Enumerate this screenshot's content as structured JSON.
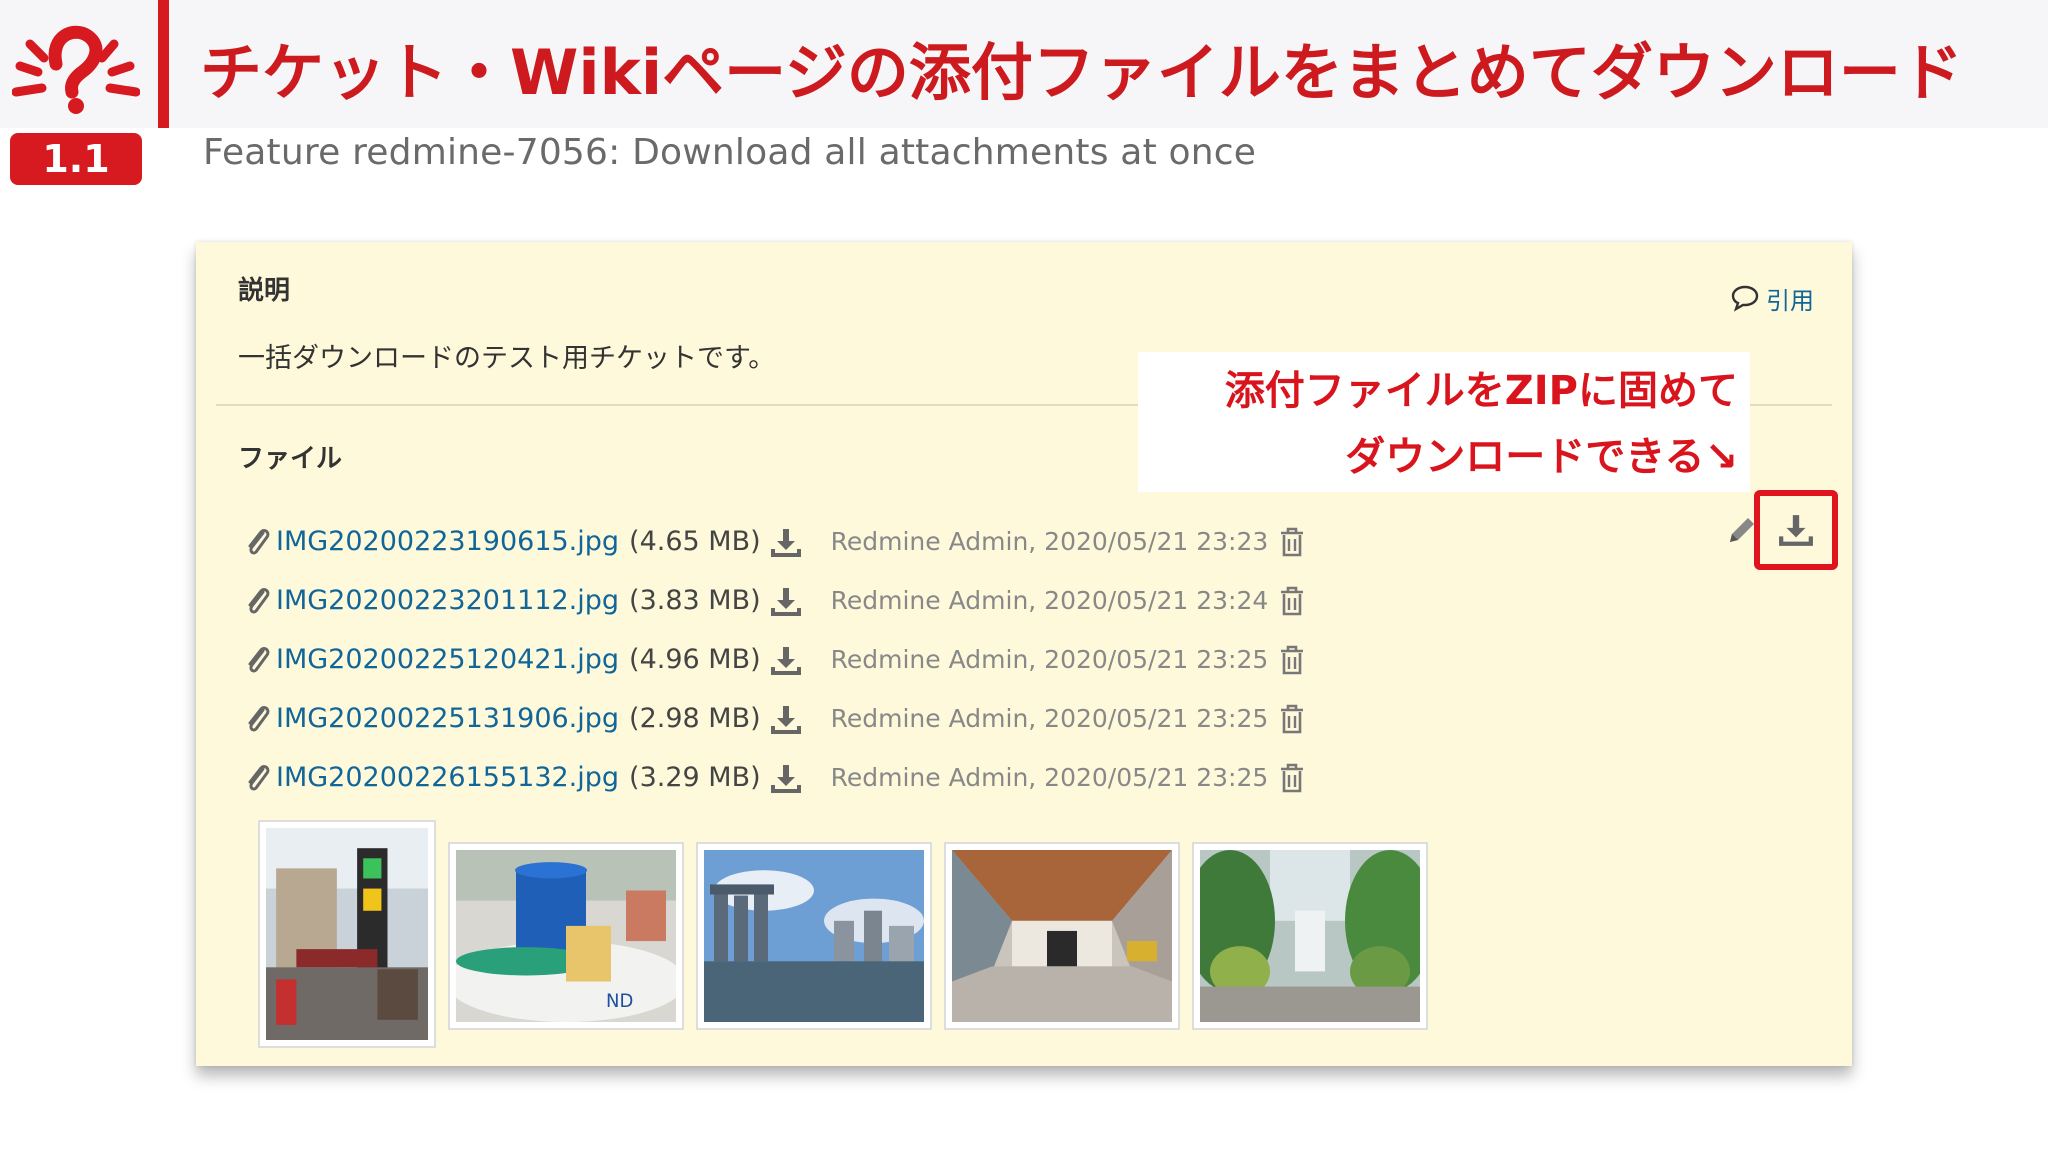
{
  "slide": {
    "version": "1.1",
    "title": "チケット・Wikiページの添付ファイルをまとめてダウンロード",
    "subtitle": "Feature redmine-7056: Download all attachments at once"
  },
  "issue": {
    "description_heading": "説明",
    "description_text": "一括ダウンロードのテスト用チケットです。",
    "quote_label": "引用",
    "files_heading": "ファイル",
    "attachments": [
      {
        "filename": "IMG20200223190615.jpg",
        "size": "(4.65 MB)",
        "author_date": "Redmine Admin, 2020/05/21 23:23"
      },
      {
        "filename": "IMG20200223201112.jpg",
        "size": "(3.83 MB)",
        "author_date": "Redmine Admin, 2020/05/21 23:24"
      },
      {
        "filename": "IMG20200225120421.jpg",
        "size": "(4.96 MB)",
        "author_date": "Redmine Admin, 2020/05/21 23:25"
      },
      {
        "filename": "IMG20200225131906.jpg",
        "size": "(2.98 MB)",
        "author_date": "Redmine Admin, 2020/05/21 23:25"
      },
      {
        "filename": "IMG20200226155132.jpg",
        "size": "(3.29 MB)",
        "author_date": "Redmine Admin, 2020/05/21 23:25"
      }
    ]
  },
  "callout": {
    "line1": "添付ファイルをZIPに固めて",
    "line2": "ダウンロードできる↘"
  },
  "icons": {
    "logo": "redmine-logo-icon",
    "attachment": "paperclip-icon",
    "download": "download-icon",
    "delete": "trash-icon",
    "edit": "pencil-icon",
    "quote": "speech-bubble-icon",
    "download_all": "download-all-icon"
  },
  "colors": {
    "brand_red": "#d71920",
    "link_blue": "#116699",
    "box_background": "#fff9dc"
  }
}
